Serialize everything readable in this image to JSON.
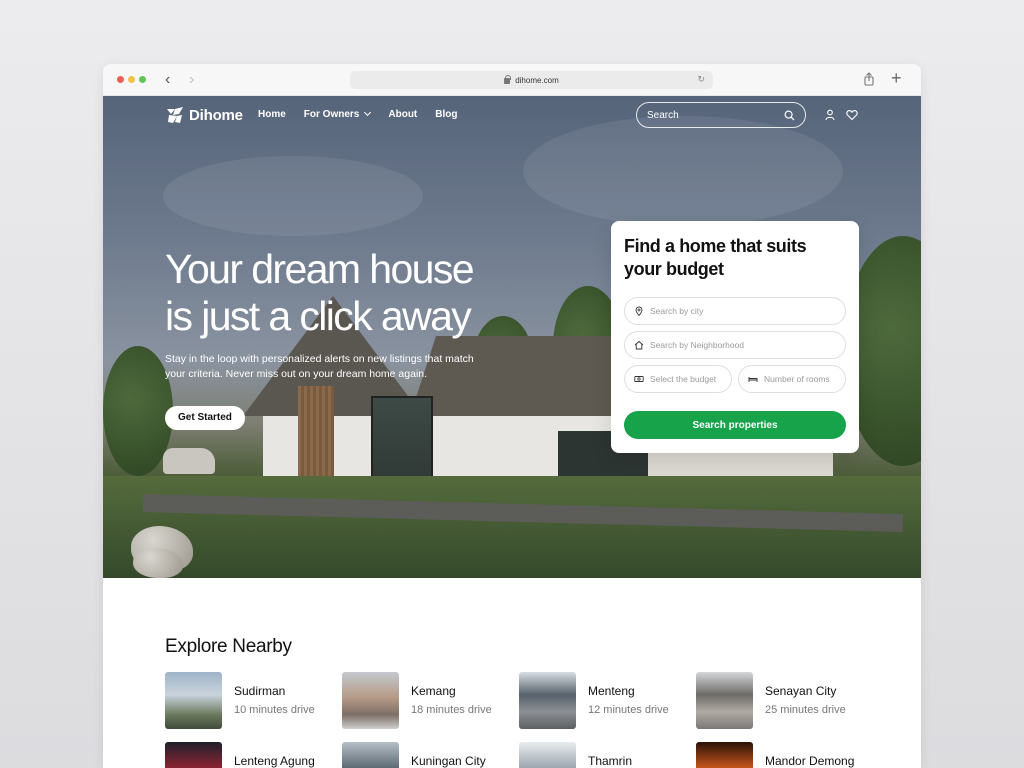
{
  "browser": {
    "url": "dihome.com"
  },
  "header": {
    "brand": "Dihome",
    "nav": [
      "Home",
      "For Owners",
      "About",
      "Blog"
    ],
    "search_label": "Search"
  },
  "hero": {
    "headline_line1": "Your dream house",
    "headline_line2": "is just a click away",
    "subtext": "Stay in the loop with personalized alerts on new listings that match your criteria. Never miss out on your dream home again.",
    "cta": "Get Started"
  },
  "finder": {
    "title": "Find a home that suits your budget",
    "city_placeholder": "Search by city",
    "neighborhood_placeholder": "Search by Neighborhood",
    "budget_placeholder": "Select the budget",
    "rooms_placeholder": "Number of rooms",
    "button": "Search properties"
  },
  "explore": {
    "title": "Explore Nearby",
    "places": [
      {
        "name": "Sudirman",
        "drive": "10 minutes drive"
      },
      {
        "name": "Kemang",
        "drive": "18 minutes drive"
      },
      {
        "name": "Menteng",
        "drive": "12 minutes drive"
      },
      {
        "name": "Senayan City",
        "drive": "25 minutes drive"
      },
      {
        "name": "Lenteng Agung",
        "drive": ""
      },
      {
        "name": "Kuningan City",
        "drive": ""
      },
      {
        "name": "Thamrin",
        "drive": ""
      },
      {
        "name": "Mandor Demong",
        "drive": ""
      }
    ]
  },
  "colors": {
    "accent_green": "#16a34a",
    "hero_text": "#ffffff"
  }
}
